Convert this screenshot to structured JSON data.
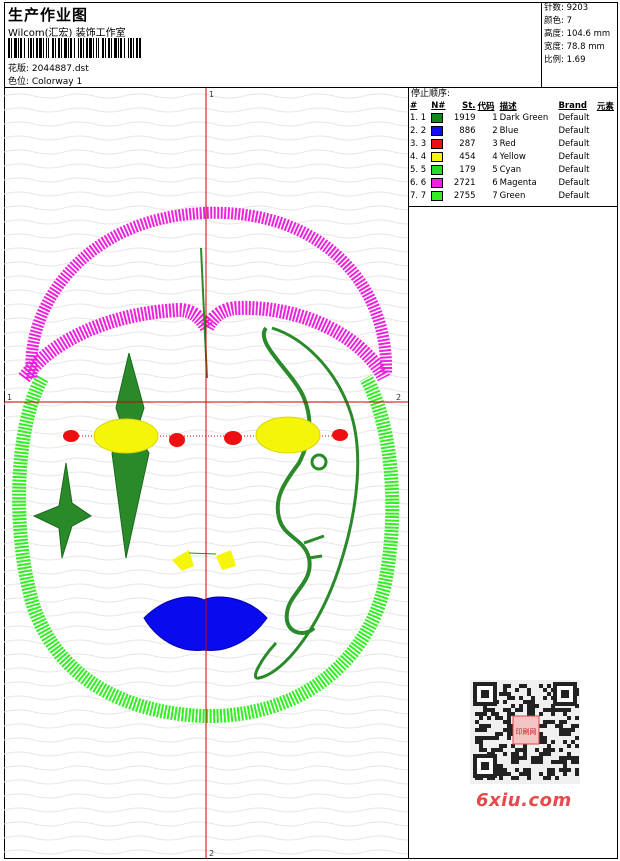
{
  "header": {
    "title": "生产作业图",
    "subtitle": "Wilcom(汇宏) 装饰工作室",
    "design_label": "花版: 2044887.dst",
    "color_label": "色位: Colorway 1"
  },
  "stats": {
    "stitches": "针数: 9203",
    "colors": "颜色: 7",
    "height": "高度: 104.6 mm",
    "width": "宽度: 78.8 mm",
    "scale": "比例: 1.69"
  },
  "canvas": {
    "axis_top": "1",
    "axis_bottom": "2",
    "axis_left": "1",
    "axis_right": "2",
    "palette": {
      "dark_green": "#2a8a2a",
      "blue": "#0a0aee",
      "red": "#ee1010",
      "yellow": "#f5f50a",
      "cyan": "#22dd22",
      "magenta": "#ee22dd",
      "green": "#33ee22",
      "crosshair": "#cc0000"
    }
  },
  "stop_panel": {
    "heading": "停止顺序:",
    "columns": [
      "#",
      "N#",
      "St.",
      "代码",
      "描述",
      "Brand",
      "元素"
    ],
    "rows": [
      {
        "idx": "1. 1",
        "color": "#0e8a18",
        "st": "1919",
        "code": "1",
        "desc": "Dark Green",
        "brand": "Default",
        "elem": ""
      },
      {
        "idx": "2. 2",
        "color": "#1010ee",
        "st": "886",
        "code": "2",
        "desc": "Blue",
        "brand": "Default",
        "elem": ""
      },
      {
        "idx": "3. 3",
        "color": "#ee1010",
        "st": "287",
        "code": "3",
        "desc": "Red",
        "brand": "Default",
        "elem": ""
      },
      {
        "idx": "4. 4",
        "color": "#f5f50a",
        "st": "454",
        "code": "4",
        "desc": "Yellow",
        "brand": "Default",
        "elem": ""
      },
      {
        "idx": "5. 5",
        "color": "#22dd22",
        "st": "179",
        "code": "5",
        "desc": "Cyan",
        "brand": "Default",
        "elem": ""
      },
      {
        "idx": "6. 6",
        "color": "#ee22dd",
        "st": "2721",
        "code": "6",
        "desc": "Magenta",
        "brand": "Default",
        "elem": ""
      },
      {
        "idx": "7. 7",
        "color": "#33ee22",
        "st": "2755",
        "code": "7",
        "desc": "Green",
        "brand": "Default",
        "elem": ""
      }
    ]
  },
  "watermark": {
    "qr_text": "印刷网",
    "site": "6xiu.com"
  }
}
